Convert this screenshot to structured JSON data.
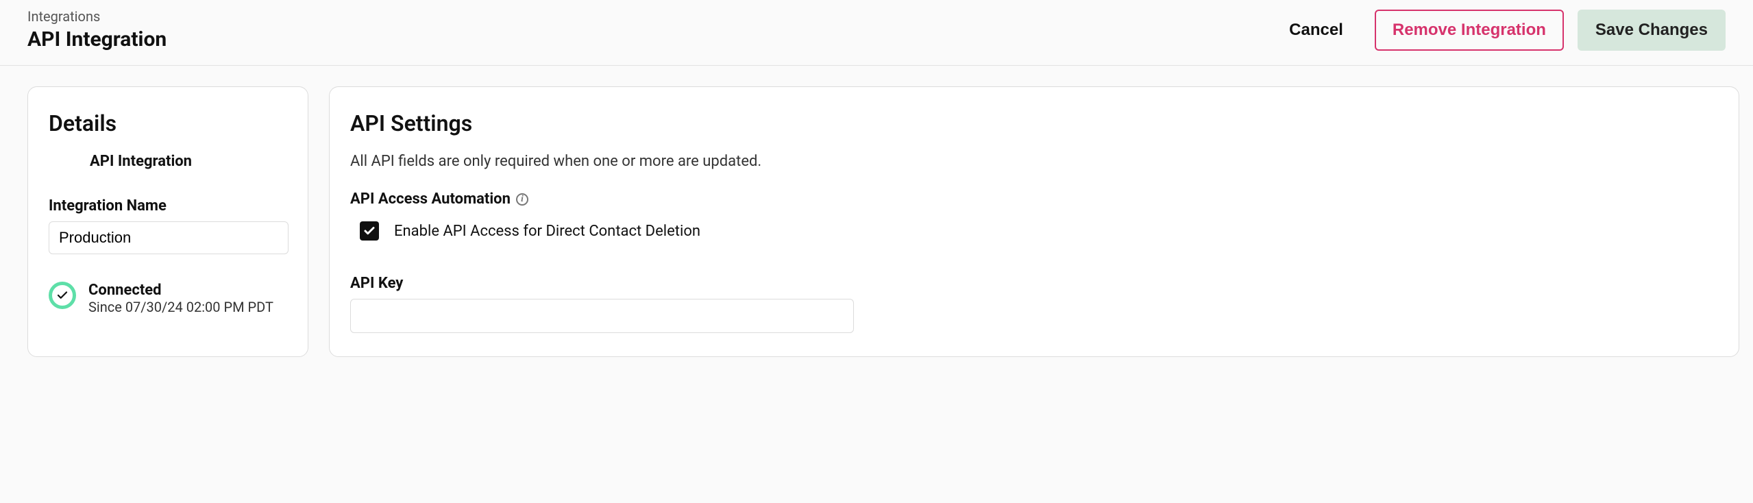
{
  "header": {
    "breadcrumb": "Integrations",
    "title": "API Integration",
    "actions": {
      "cancel": "Cancel",
      "remove": "Remove Integration",
      "save": "Save Changes"
    }
  },
  "details": {
    "section_title": "Details",
    "integration_type_label": "API Integration",
    "name_field_label": "Integration Name",
    "name_value": "Production",
    "status_state": "Connected",
    "status_since": "Since 07/30/24 02:00 PM PDT"
  },
  "settings": {
    "section_title": "API Settings",
    "help_text": "All API fields are only required when one or more are updated.",
    "access_group_title": "API Access Automation",
    "access_checkbox_checked": true,
    "access_checkbox_label": "Enable API Access for Direct Contact Deletion",
    "api_key_label": "API Key",
    "api_key_value": ""
  }
}
